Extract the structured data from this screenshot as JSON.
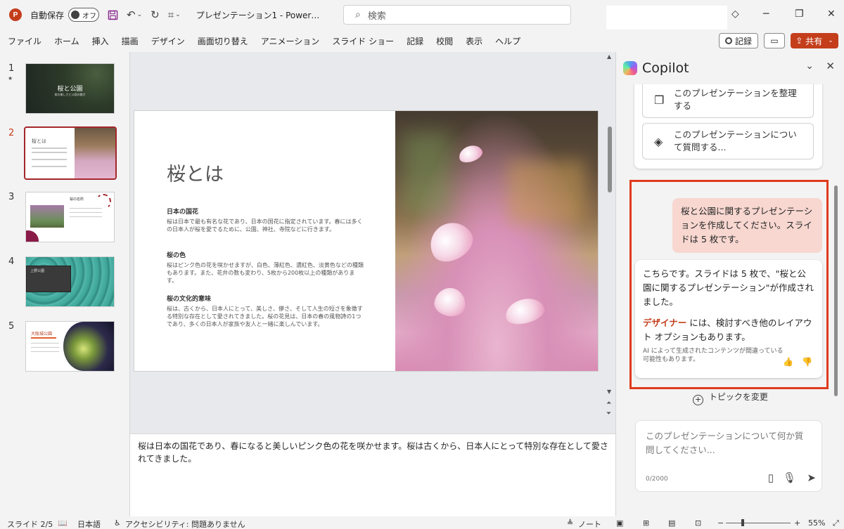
{
  "titlebar": {
    "app_logo": "P",
    "autosave_label": "自動保存",
    "autosave_state": "オフ",
    "doc_title": "プレゼンテーション1  -  Power…",
    "search_placeholder": "検索",
    "icons": [
      "powerpoint-icon",
      "save-icon",
      "undo-icon",
      "redo-icon",
      "customize-icon",
      "diamond-icon",
      "restore-icon",
      "close-icon"
    ]
  },
  "ribbon": {
    "tabs": [
      "ファイル",
      "ホーム",
      "挿入",
      "描画",
      "デザイン",
      "画面切り替え",
      "アニメーション",
      "スライド ショー",
      "記録",
      "校閲",
      "表示",
      "ヘルプ"
    ],
    "record_label": "記録",
    "share_label": "共有"
  },
  "thumbnails": {
    "numbers": [
      "1",
      "2",
      "3",
      "4",
      "5"
    ],
    "star": "★",
    "t1_title": "桜と公園",
    "t1_subtitle": "桜の美しさと公園の魅力",
    "t2_title": "桜とは",
    "t3_title": "桜の名所",
    "t4_title": "上野公園",
    "t5_title": "大阪城公園"
  },
  "slide": {
    "title": "桜とは",
    "sections": [
      {
        "heading": "日本の国花",
        "body": "桜は日本で最も有名な花であり、日本の国花に指定されています。春には多くの日本人が桜を愛でるために、公園、神社、寺院などに行きます。"
      },
      {
        "heading": "桜の色",
        "body": "桜はピンク色の花を咲かせますが、白色、薄紅色、濃紅色、淡黄色などの種類もあります。また、花弁の数も変わり、5枚から200枚以上の種類があります。"
      },
      {
        "heading": "桜の文化的意味",
        "body": "桜は、古くから、日本人にとって、美しさ、儚さ、そして人生の短さを象徴する特別な存在として愛されてきました。桜の花見は、日本の春の風物詩の1つであり、多くの日本人が家族や友人と一緒に楽しんでいます。"
      }
    ]
  },
  "notes": {
    "text": "桜は日本の国花であり、春になると美しいピンク色の花を咲かせます。桜は古くから、日本人にとって特別な存在として愛されてきました。"
  },
  "copilot": {
    "title": "Copilot",
    "suggestions": [
      "このプレゼンテーションを整理する",
      "このプレゼンテーションについて質問する..."
    ],
    "user_message": "桜と公園に関するプレゼンテーションを作成してください。スライドは 5 枚です。",
    "ai_message_1": "こちらです。スライドは 5 枚で、\"桜と公園に関するプレゼンテーション\"が作成されました。",
    "ai_designer": "デザイナー",
    "ai_message_2": " には、検討すべき他のレイアウト オプションもあります。",
    "ai_disclaimer": "AI によって生成されたコンテンツが間違っている可能性もあります。",
    "change_topic": "トピックを変更",
    "input_placeholder": "このプレゼンテーションについて何か質問してください...",
    "char_count": "0/2000"
  },
  "statusbar": {
    "slide_indicator": "スライド 2/5",
    "language": "日本語",
    "accessibility": "アクセシビリティ: 問題ありません",
    "notes_label": "ノート",
    "zoom": "55%",
    "zoom_minus": "−",
    "zoom_plus": "+"
  },
  "colors": {
    "accent": "#c43e1c",
    "highlight_border": "#e03a1e",
    "user_bubble": "#f7d7d0"
  }
}
